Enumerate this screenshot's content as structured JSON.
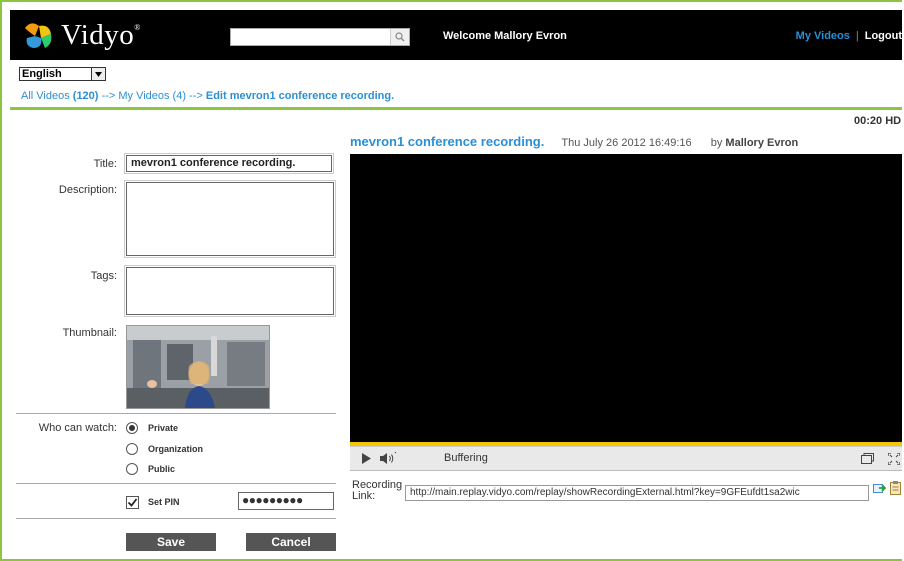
{
  "header": {
    "logo_text": "Vidyo",
    "search": {
      "value": "",
      "placeholder": ""
    },
    "welcome": "Welcome Mallory Evron",
    "nav": {
      "my_videos": "My Videos",
      "separator": "|",
      "logout": "Logout"
    }
  },
  "language": {
    "selected": "English"
  },
  "breadcrumb": {
    "all_videos_text": "All Videos",
    "all_videos_count": "(120)",
    "arrow1": " --> ",
    "my_videos": "My Videos (4)",
    "arrow2": " --> ",
    "current": "Edit mevron1 conference recording."
  },
  "video": {
    "duration": "00:20 HD",
    "title": "mevron1 conference recording.",
    "date": "Thu July 26 2012 16:49:16",
    "by_prefix": "by",
    "author": "Mallory Evron",
    "status": "Buffering",
    "progress": 1.0
  },
  "form": {
    "title_label": "Title:",
    "title_value": "mevron1 conference recording.",
    "description_label": "Description:",
    "description_value": "",
    "tags_label": "Tags:",
    "tags_value": "",
    "thumbnail_label": "Thumbnail:",
    "who_can_watch_label": "Who can watch:",
    "options": [
      "Private",
      "Organization",
      "Public"
    ],
    "selected_option": "Private",
    "set_pin_label": "Set PIN",
    "set_pin_checked": true,
    "pin_value": "●●●●●●●●●",
    "save_label": "Save",
    "cancel_label": "Cancel"
  },
  "recording": {
    "label_line1": "Recording",
    "label_line2": "Link:",
    "url": "http://main.replay.vidyo.com/replay/showRecordingExternal.html?key=9GFEufdt1sa2wic"
  },
  "colors": {
    "accent": "#2b8fd6",
    "border_green": "#8cc63f",
    "progress": "#f2c70a"
  }
}
